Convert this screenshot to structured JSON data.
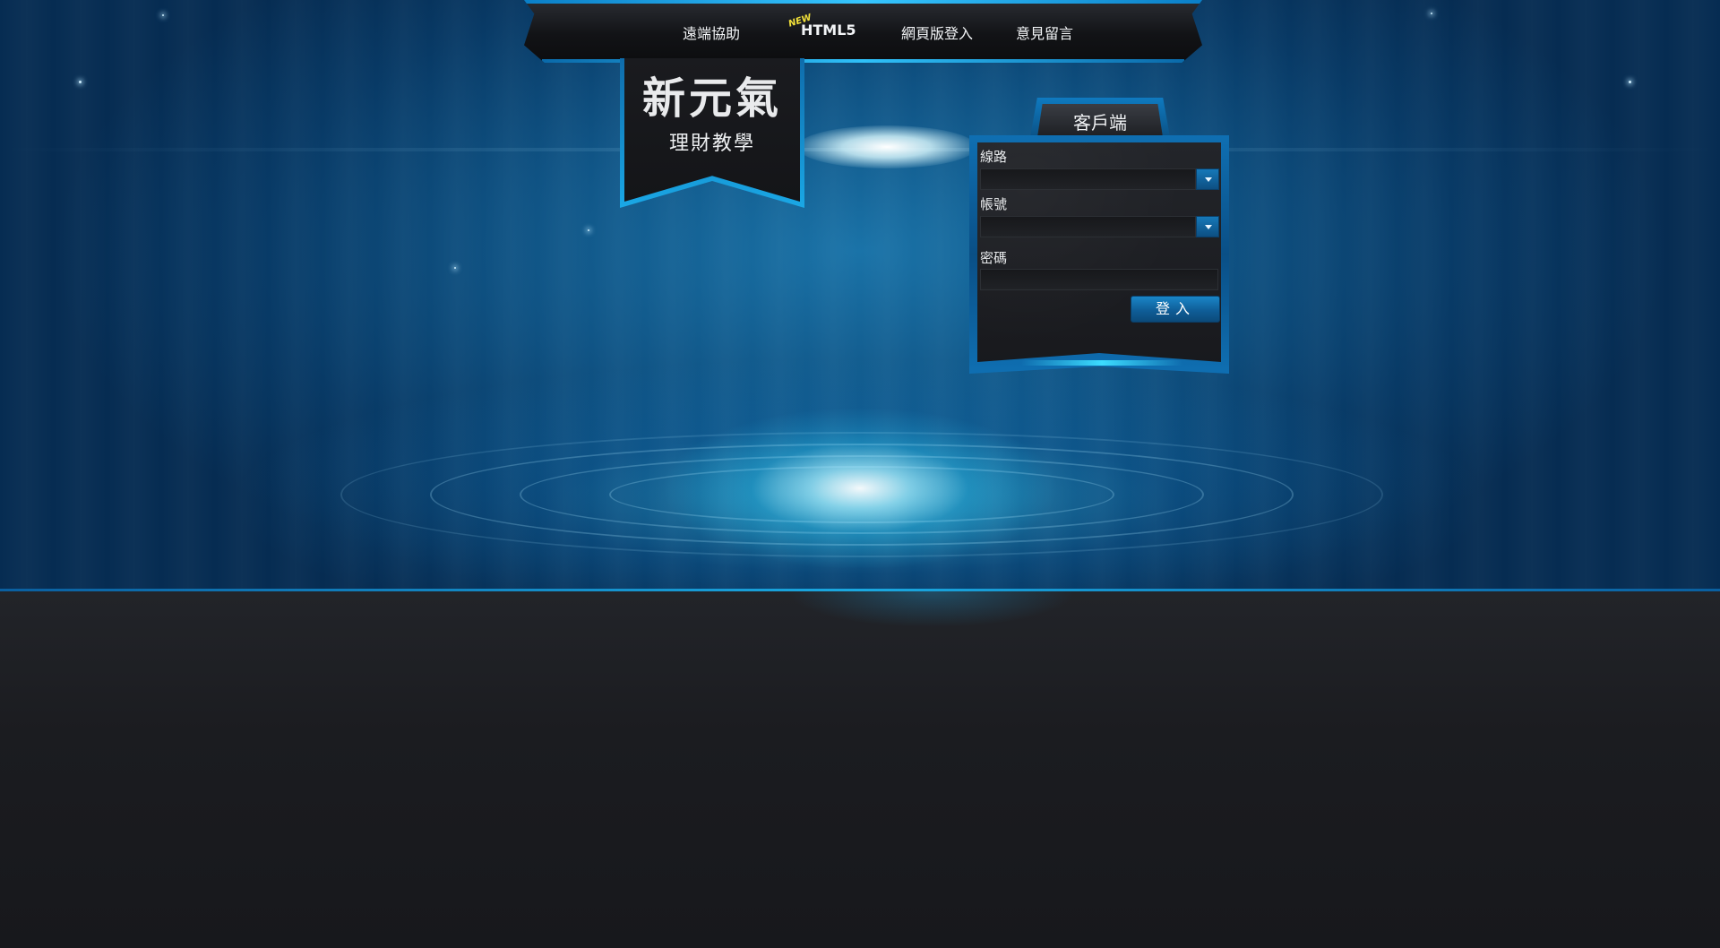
{
  "nav": {
    "items": [
      {
        "label": "遠端協助"
      },
      {
        "label": "HTML5",
        "badge": "NEW"
      },
      {
        "label": "網頁版登入"
      },
      {
        "label": "意見留言"
      }
    ]
  },
  "logo": {
    "title": "新元氣",
    "subtitle": "理財教學"
  },
  "login_panel": {
    "tab_label": "客戶端",
    "fields": {
      "line_label": "線路",
      "line_value": "",
      "account_label": "帳號",
      "account_value": "",
      "password_label": "密碼",
      "password_value": ""
    },
    "submit_label": "登入"
  },
  "colors": {
    "accent": "#1aa8e0",
    "panel_bg": "#1d1f23",
    "floor_bg": "#1b1c20",
    "badge": "#f3e23a"
  }
}
